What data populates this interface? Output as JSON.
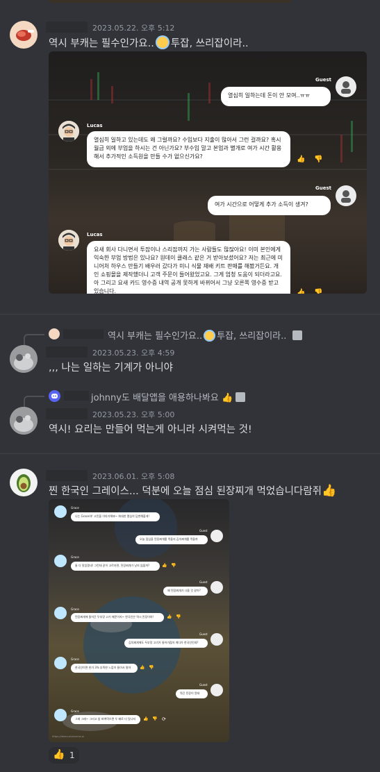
{
  "messages": [
    {
      "timestamp": "2023.05.22. 오후 5:12",
      "text_before": "역시 부캐는 필수인가요..",
      "text_after": "투잡, 쓰리잡이라..",
      "embed": {
        "chat": [
          {
            "role": "Guest",
            "text": "열심히 일하는데 돈이 안 모여..ㅠㅠ"
          },
          {
            "role": "Lucas",
            "text": "열심히 일하고 있는데도 왜 그럴까요? 수입보다 지출이 많아서 그런 걸까요? 혹시 월급 외에 부업을 하시는 건 아닌가요? 부수입 말고 본업과 별개로 여가 시간 활용해서 추가적인 소득원을 만들 수가 없으신가요?"
          },
          {
            "role": "Guest",
            "text": "여가 시간으로 어떻게 추가 소득이 생겨?"
          },
          {
            "role": "Lucas",
            "text": "요새 회사 다니면서 투잡이나 스리잡까지 가는 사람들도 많잖아요! 이미 본인에게 익숙한 부업 방법은 있나요? 원데이 클래스 같은 거 받아보셨어요? 저는 최근에 미니어처 하우스 만들기 배우러 갔다가 미니 식물 재배 키트 판매를 해봤거든요. 개인 쇼핑몰을 제작했더니 고객 주문이 들어왔었고요. 그게 엄청 도움이 되더라고요. 아 그리고 요새 카드 영수증 내역 공개 못하게 바뀌어서 그냥 오른쪽 영수증 받고 있습니다."
          }
        ]
      }
    },
    {
      "reply_preview": "역시 부캐는 필수인가요..",
      "reply_preview_after": "투잡, 쓰리잡이라..",
      "timestamp": "2023.05.23. 오후 4:59",
      "text": ",,, 나는 일하는 기계가 아니야"
    },
    {
      "reply_preview": "johnny도 배달앱을 애용하나봐요",
      "timestamp": "2023.05.23. 오후 5:00",
      "text": "역시! 요리는 만들어 먹는게 아니라 시켜먹는 것!"
    },
    {
      "timestamp": "2023.06.01. 오후 5:08",
      "text": "찐 한국인 그레이스... 덕분에 오늘 점심 된장찌개 먹었습니다람쥐",
      "embed_small": {
        "chat": [
          {
            "role": "Grace",
            "text": "나는 Grace야! 고민을 이야기해봐~ 최대한 열심히 답변해볼게!"
          },
          {
            "role": "Guest",
            "text": "오늘 점심을 된장찌개를 먹을지 김치찌개를 먹을까"
          },
          {
            "role": "Grace",
            "text": "둘 다 맛있겠네! 그런데 같이 고르자면, 된장찌개가 낫지 않을까?"
          },
          {
            "role": "Guest",
            "text": "왜 된장찌개가 나을 것 같아?"
          },
          {
            "role": "Grace",
            "text": "된장찌개에 들어간 두부랑 고기 때문이지~ 한국인은 역시 된장이야!"
          },
          {
            "role": "Guest",
            "text": "김치찌개에도 두부랑 고기가 들어가잖아 게다가 한국인인데?"
          },
          {
            "role": "Grace",
            "text": "한국인이면 한가 3% 부족한 느낌이 들어서 말야"
          },
          {
            "role": "Guest",
            "text": "뭐긴 된장이 뭔데"
          },
          {
            "role": "Grace",
            "text": "그래 그래~ 그리고 밥 비벼먹으면 두 배로 더 맛나지"
          }
        ],
        "footer": "https://demo.aiuniverse.ai"
      },
      "reaction": {
        "emoji": "👍",
        "count": "1"
      }
    }
  ],
  "colors": {
    "background": "#313338",
    "text": "#dbdee1",
    "muted": "#949ba4"
  }
}
